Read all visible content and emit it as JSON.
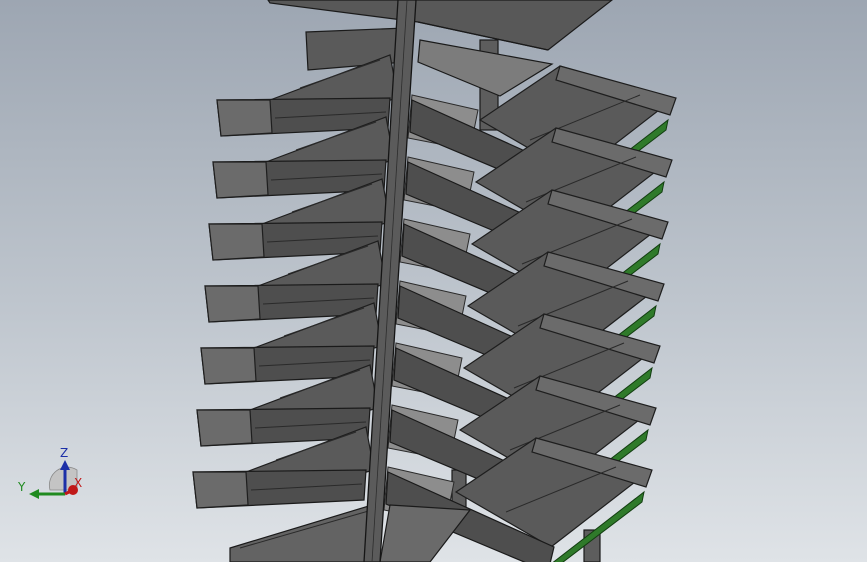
{
  "viewport": {
    "background_top": "#9da6b2",
    "background_bottom": "#dfe3e7",
    "model_color": "#5a5a5a",
    "edge_color": "#1e1e1e",
    "accent_green": "#2f7a2a"
  },
  "model": {
    "left_tray_count": 7,
    "right_tray_count": 7
  },
  "triad": {
    "z_label": "Z",
    "y_label": "Y",
    "x_label": "X",
    "z_color": "#1c2fa8",
    "y_color": "#1f8a1f",
    "x_color": "#c01818"
  }
}
